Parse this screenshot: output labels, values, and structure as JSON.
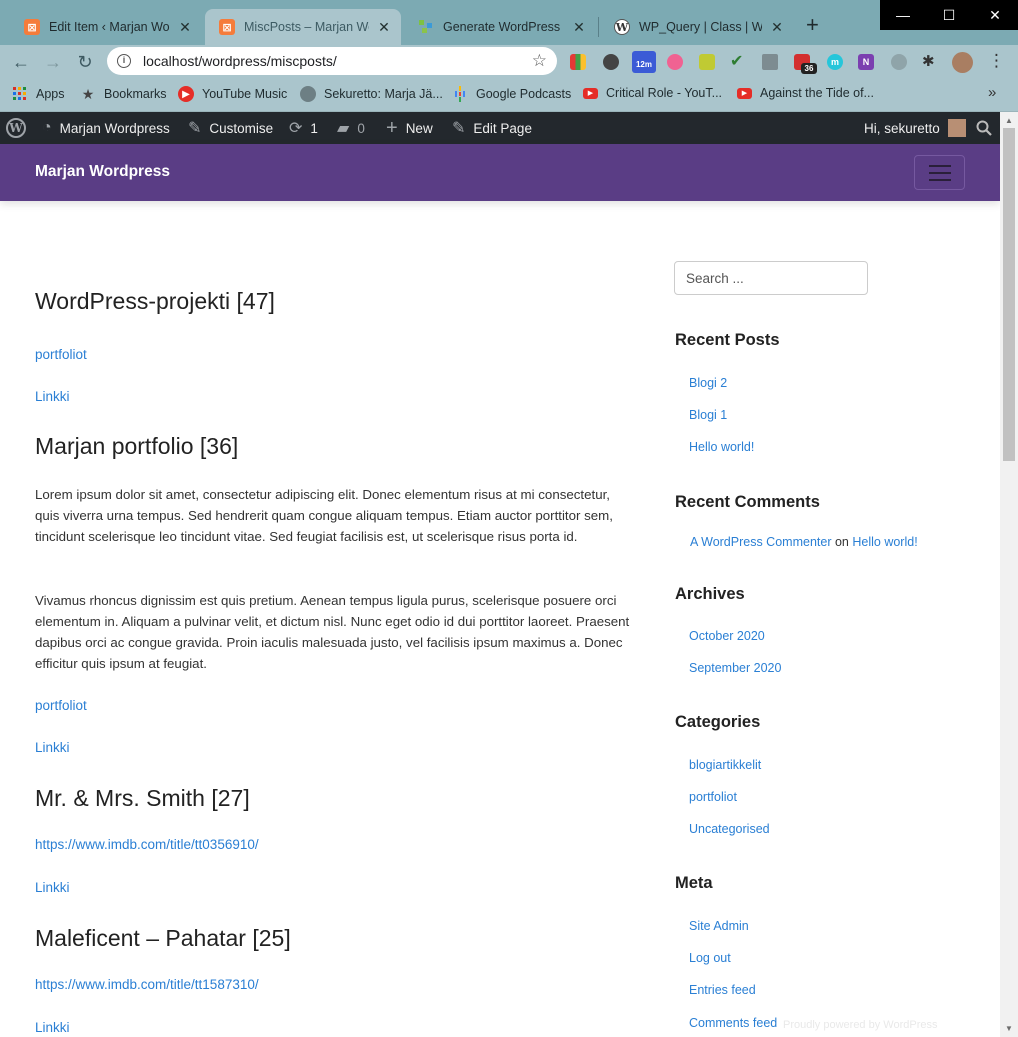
{
  "browser": {
    "tabs": [
      {
        "title": "Edit Item ‹ Marjan Wordpress",
        "favicon": "xampp-icon",
        "active": false
      },
      {
        "title": "MiscPosts – Marjan Wordpress",
        "favicon": "xampp-icon",
        "active": true
      },
      {
        "title": "Generate WordPress Posts",
        "favicon": "generator-icon",
        "active": false
      },
      {
        "title": "WP_Query | Class | WordPress",
        "favicon": "wordpress-icon",
        "active": false
      }
    ],
    "url": "localhost/wordpress/miscposts/",
    "extension_badges": {
      "timer": "12m",
      "notifications": "36",
      "momentum": "m",
      "onenote": "N"
    },
    "bookmarks": [
      {
        "label": "Apps",
        "icon": "apps-grid-icon"
      },
      {
        "label": "Bookmarks",
        "icon": "star-icon"
      },
      {
        "label": "YouTube Music",
        "icon": "youtube-music-icon"
      },
      {
        "label": "Sekuretto: Marja Jä...",
        "icon": "globe-icon"
      },
      {
        "label": "Google Podcasts",
        "icon": "podcasts-icon"
      },
      {
        "label": "Critical Role - YouT...",
        "icon": "youtube-icon"
      },
      {
        "label": "Against the Tide of...",
        "icon": "youtube-icon"
      }
    ]
  },
  "adminbar": {
    "site_name": "Marjan Wordpress",
    "customise": "Customise",
    "updates": "1",
    "comments": "0",
    "new": "New",
    "edit_page": "Edit Page",
    "greeting": "Hi, sekuretto"
  },
  "site": {
    "title": "Marjan Wordpress"
  },
  "posts": [
    {
      "title": "WordPress-projekti [47]",
      "category": "portfoliot",
      "link": "Linkki",
      "paragraphs": []
    },
    {
      "title": "Marjan portfolio [36]",
      "paragraphs": [
        "Lorem ipsum dolor sit amet, consectetur adipiscing elit. Donec elementum risus at mi consectetur, quis viverra urna tempus. Sed hendrerit quam congue aliquam tempus. Etiam auctor porttitor sem, tincidunt scelerisque leo tincidunt vitae. Sed feugiat facilisis est, ut scelerisque risus porta id.",
        "Vivamus rhoncus dignissim est quis pretium. Aenean tempus ligula purus, scelerisque posuere orci elementum in. Aliquam a pulvinar velit, et dictum nisl. Nunc eget odio id dui porttitor laoreet. Praesent dapibus orci ac congue gravida. Proin iaculis malesuada justo, vel facilisis ipsum maximus a. Donec efficitur quis ipsum at feugiat."
      ],
      "category": "portfoliot",
      "link": "Linkki"
    },
    {
      "title": "Mr. & Mrs. Smith [27]",
      "category": "https://www.imdb.com/title/tt0356910/",
      "link": "Linkki",
      "paragraphs": []
    },
    {
      "title": "Maleficent – Pahatar [25]",
      "category": "https://www.imdb.com/title/tt1587310/",
      "link": "Linkki",
      "paragraphs": []
    }
  ],
  "sidebar": {
    "search_placeholder": "Search ...",
    "recent_posts": {
      "heading": "Recent Posts",
      "items": [
        "Blogi 2",
        "Blogi 1",
        "Hello world!"
      ]
    },
    "recent_comments": {
      "heading": "Recent Comments",
      "author": "A WordPress Commenter",
      "on": "on",
      "post": "Hello world!"
    },
    "archives": {
      "heading": "Archives",
      "items": [
        "October 2020",
        "September 2020"
      ]
    },
    "categories": {
      "heading": "Categories",
      "items": [
        "blogiartikkelit",
        "portfoliot",
        "Uncategorised"
      ]
    },
    "meta": {
      "heading": "Meta",
      "items": [
        "Site Admin",
        "Log out",
        "Entries feed",
        "Comments feed"
      ]
    }
  },
  "footer_ghost": "Proudly powered by WordPress",
  "colors": {
    "accent_purple": "#5a3d85",
    "link_blue": "#2a7fd4",
    "adminbar": "#23282d",
    "tab_strip": "#7caab3"
  }
}
